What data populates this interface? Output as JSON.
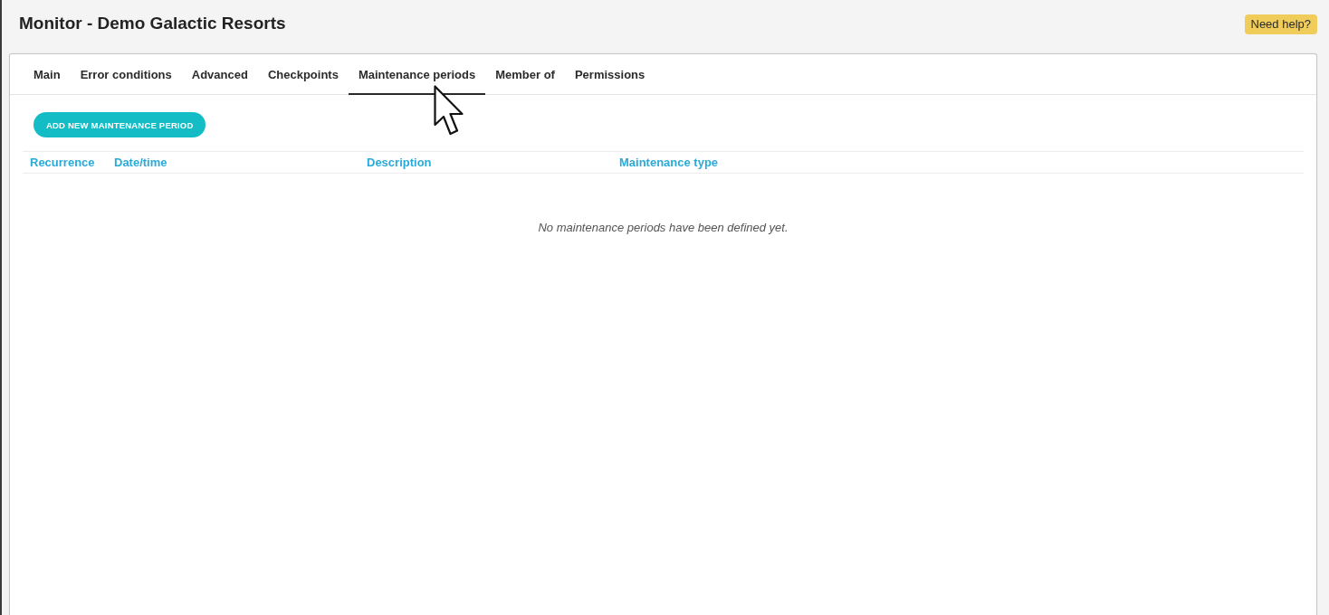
{
  "header": {
    "title": "Monitor - Demo Galactic Resorts",
    "help_button": "Need help?"
  },
  "tabs": [
    {
      "label": "Main",
      "selected": false
    },
    {
      "label": "Error conditions",
      "selected": false
    },
    {
      "label": "Advanced",
      "selected": false
    },
    {
      "label": "Checkpoints",
      "selected": false
    },
    {
      "label": "Maintenance periods",
      "selected": true
    },
    {
      "label": "Member of",
      "selected": false
    },
    {
      "label": "Permissions",
      "selected": false
    }
  ],
  "add_button": "ADD NEW MAINTENANCE PERIOD",
  "table": {
    "columns": [
      "Recurrence",
      "Date/time",
      "Description",
      "Maintenance type"
    ],
    "empty_message": "No maintenance periods have been defined yet."
  }
}
